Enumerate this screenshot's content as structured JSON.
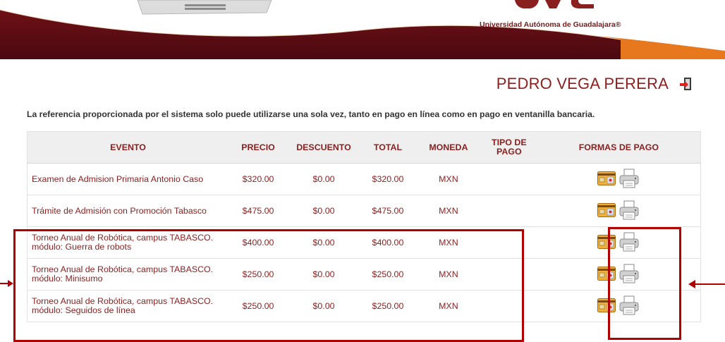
{
  "header": {
    "university_name": "Universidad Autónoma de Guadalajara®"
  },
  "user": {
    "name": "PEDRO VEGA PERERA",
    "logout_icon": "logout-icon"
  },
  "notice": "La referencia proporcionada por el sistema solo puede utilizarse una sola vez, tanto en pago en línea como en pago en ventanilla bancaria.",
  "table": {
    "columns": [
      "EVENTO",
      "PRECIO",
      "DESCUENTO",
      "TOTAL",
      "MONEDA",
      "TIPO DE PAGO",
      "FORMAS DE PAGO"
    ],
    "rows": [
      {
        "evento_l1": "Examen de Admision Primaria Antonio Caso",
        "evento_l2": "",
        "precio": "$320.00",
        "descuento": "$0.00",
        "total": "$320.00",
        "moneda": "MXN",
        "tipo": ""
      },
      {
        "evento_l1": "Trámite de Admisión con Promoción Tabasco",
        "evento_l2": "",
        "precio": "$475.00",
        "descuento": "$0.00",
        "total": "$475.00",
        "moneda": "MXN",
        "tipo": ""
      },
      {
        "evento_l1": "Torneo Anual de Robótica, campus TABASCO.",
        "evento_l2": "módulo: Guerra de robots",
        "precio": "$400.00",
        "descuento": "$0.00",
        "total": "$400.00",
        "moneda": "MXN",
        "tipo": ""
      },
      {
        "evento_l1": "Torneo Anual de Robótica, campus TABASCO.",
        "evento_l2": "módulo: Minisumo",
        "precio": "$250.00",
        "descuento": "$0.00",
        "total": "$250.00",
        "moneda": "MXN",
        "tipo": ""
      },
      {
        "evento_l1": "Torneo Anual de Robótica, campus TABASCO.",
        "evento_l2": "módulo: Seguidos de línea",
        "precio": "$250.00",
        "descuento": "$0.00",
        "total": "$250.00",
        "moneda": "MXN",
        "tipo": ""
      }
    ]
  },
  "payment_icons": [
    "card-payment-icon",
    "print-reference-icon"
  ],
  "colors": {
    "brand": "#8a1f1f",
    "highlight": "#b00000",
    "orange": "#e8781e"
  }
}
